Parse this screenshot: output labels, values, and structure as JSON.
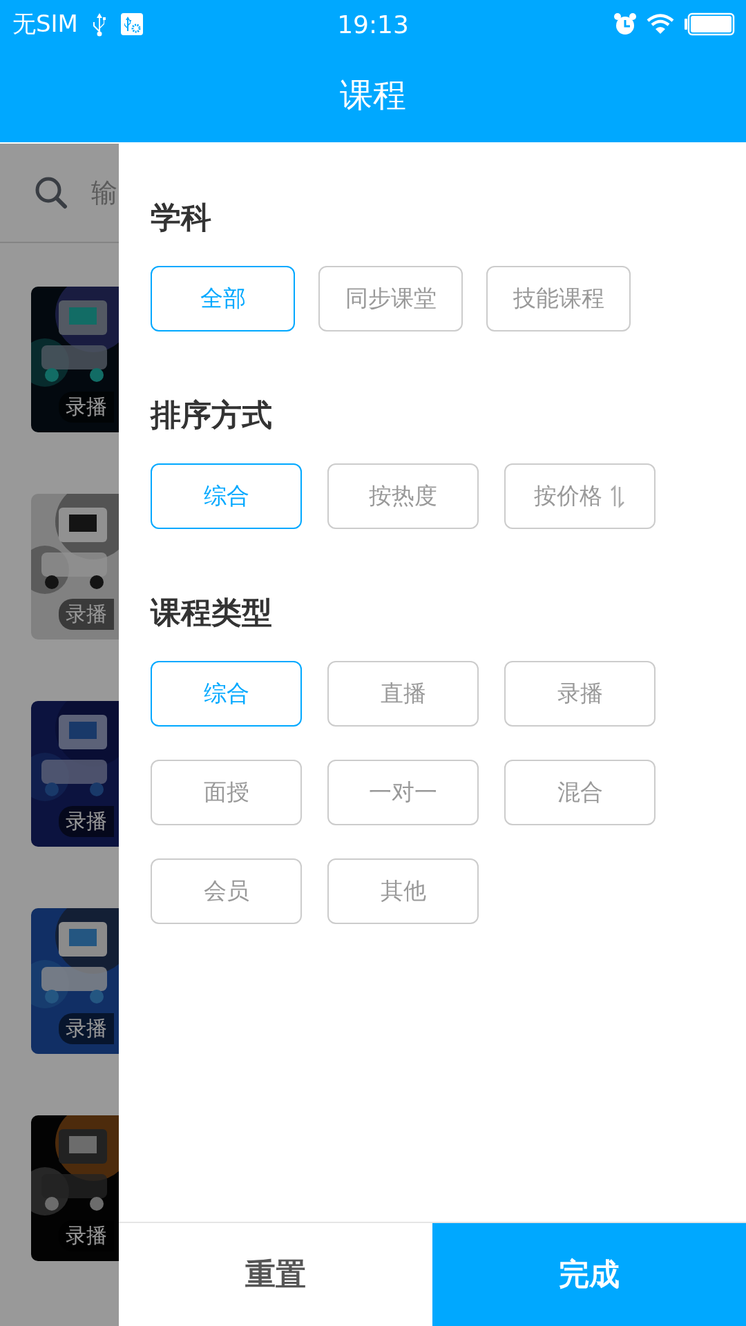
{
  "status_bar": {
    "carrier": "无SIM",
    "time": "19:13"
  },
  "nav_bar": {
    "title": "课程"
  },
  "background": {
    "search": {
      "placeholder": "输"
    },
    "courses": [
      {
        "badge": "录播",
        "kind": "picture"
      },
      {
        "badge": "录播",
        "kind": "picture"
      },
      {
        "badge": "录播",
        "kind": "picture"
      },
      {
        "badge": "录播",
        "kind": "picture"
      },
      {
        "badge": "录播",
        "kind": "picture"
      }
    ]
  },
  "filter_panel": {
    "sections": [
      {
        "title": "学科",
        "options": [
          {
            "label": "全部",
            "selected": true,
            "kind": "plain"
          },
          {
            "label": "同步课堂",
            "selected": false,
            "kind": "plain"
          },
          {
            "label": "技能课程",
            "selected": false,
            "kind": "plain"
          }
        ]
      },
      {
        "title": "排序方式",
        "options": [
          {
            "label": "综合",
            "selected": true,
            "kind": "plain"
          },
          {
            "label": "按热度",
            "selected": false,
            "kind": "plain"
          },
          {
            "label": "按价格",
            "selected": false,
            "kind": "sort"
          }
        ]
      },
      {
        "title": "课程类型",
        "options": [
          {
            "label": "综合",
            "selected": true,
            "kind": "plain"
          },
          {
            "label": "直播",
            "selected": false,
            "kind": "plain"
          },
          {
            "label": "录播",
            "selected": false,
            "kind": "plain"
          },
          {
            "label": "面授",
            "selected": false,
            "kind": "plain"
          },
          {
            "label": "一对一",
            "selected": false,
            "kind": "plain"
          },
          {
            "label": "混合",
            "selected": false,
            "kind": "plain"
          },
          {
            "label": "会员",
            "selected": false,
            "kind": "plain"
          },
          {
            "label": "其他",
            "selected": false,
            "kind": "plain"
          }
        ]
      }
    ],
    "reset_button": "重置",
    "done_button": "完成"
  }
}
